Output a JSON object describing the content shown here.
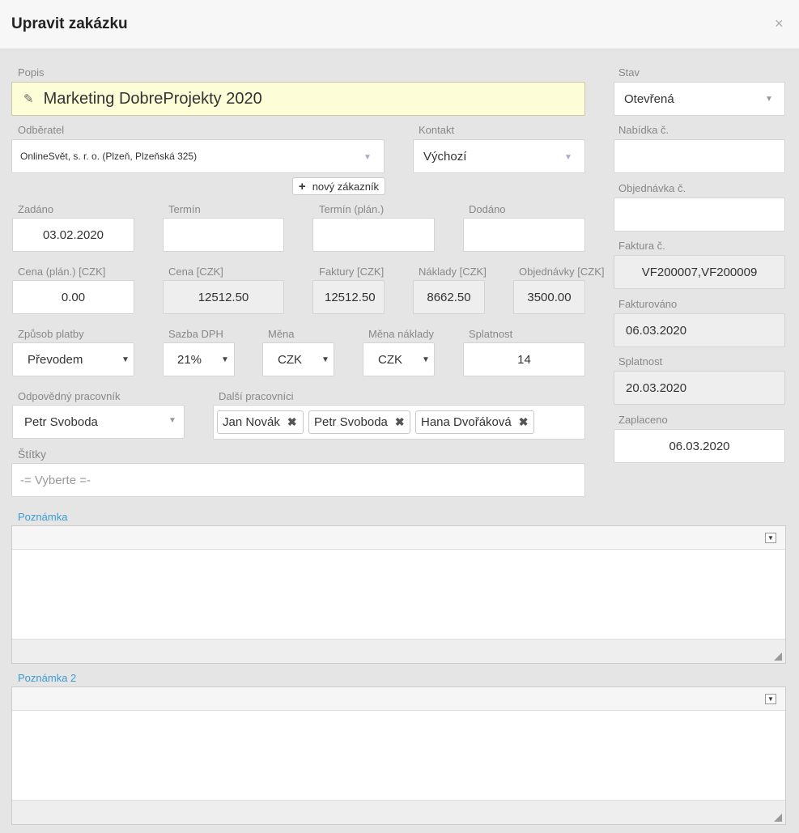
{
  "header": {
    "title": "Upravit zakázku",
    "close": "×"
  },
  "popis": {
    "label": "Popis",
    "value": "Marketing DobreProjekty 2020"
  },
  "stav": {
    "label": "Stav",
    "value": "Otevřená"
  },
  "odberatel": {
    "label": "Odběratel",
    "value": "OnlineSvět, s. r. o. (Plzeň, Plzeňská 325)"
  },
  "kontakt": {
    "label": "Kontakt",
    "value": "Výchozí"
  },
  "novy_zakaznik": "nový zákazník",
  "nabidka": {
    "label": "Nabídka č.",
    "value": ""
  },
  "objednavka": {
    "label": "Objednávka č.",
    "value": ""
  },
  "zadano": {
    "label": "Zadáno",
    "value": "03.02.2020"
  },
  "termin": {
    "label": "Termín",
    "value": ""
  },
  "termin_plan": {
    "label": "Termín (plán.)",
    "value": ""
  },
  "dodano": {
    "label": "Dodáno",
    "value": ""
  },
  "faktura_c": {
    "label": "Faktura č.",
    "value": "VF200007,VF200009"
  },
  "cena_plan": {
    "label": "Cena (plán.) [CZK]",
    "value": "0.00"
  },
  "cena": {
    "label": "Cena [CZK]",
    "value": "12512.50"
  },
  "faktury": {
    "label": "Faktury [CZK]",
    "value": "12512.50"
  },
  "naklady": {
    "label": "Náklady [CZK]",
    "value": "8662.50"
  },
  "objednavky": {
    "label": "Objednávky [CZK]",
    "value": "3500.00"
  },
  "fakturovano": {
    "label": "Fakturováno",
    "value": "06.03.2020"
  },
  "zpusob_platby": {
    "label": "Způsob platby",
    "value": "Převodem"
  },
  "sazba_dph": {
    "label": "Sazba DPH",
    "value": "21%"
  },
  "mena": {
    "label": "Měna",
    "value": "CZK"
  },
  "mena_naklady": {
    "label": "Měna náklady",
    "value": "CZK"
  },
  "splatnost_dny": {
    "label": "Splatnost",
    "value": "14"
  },
  "splatnost_datum": {
    "label": "Splatnost",
    "value": "20.03.2020"
  },
  "odpovedny": {
    "label": "Odpovědný pracovník",
    "value": "Petr Svoboda"
  },
  "dalsi": {
    "label": "Další pracovníci",
    "tags": [
      "Jan Novák",
      "Petr Svoboda",
      "Hana Dvořáková"
    ]
  },
  "zaplaceno": {
    "label": "Zaplaceno",
    "value": "06.03.2020"
  },
  "stitky": {
    "label": "Štítky",
    "placeholder": "-= Vyberte =-"
  },
  "poznamka": {
    "label": "Poznámka"
  },
  "poznamka2": {
    "label": "Poznámka 2"
  }
}
